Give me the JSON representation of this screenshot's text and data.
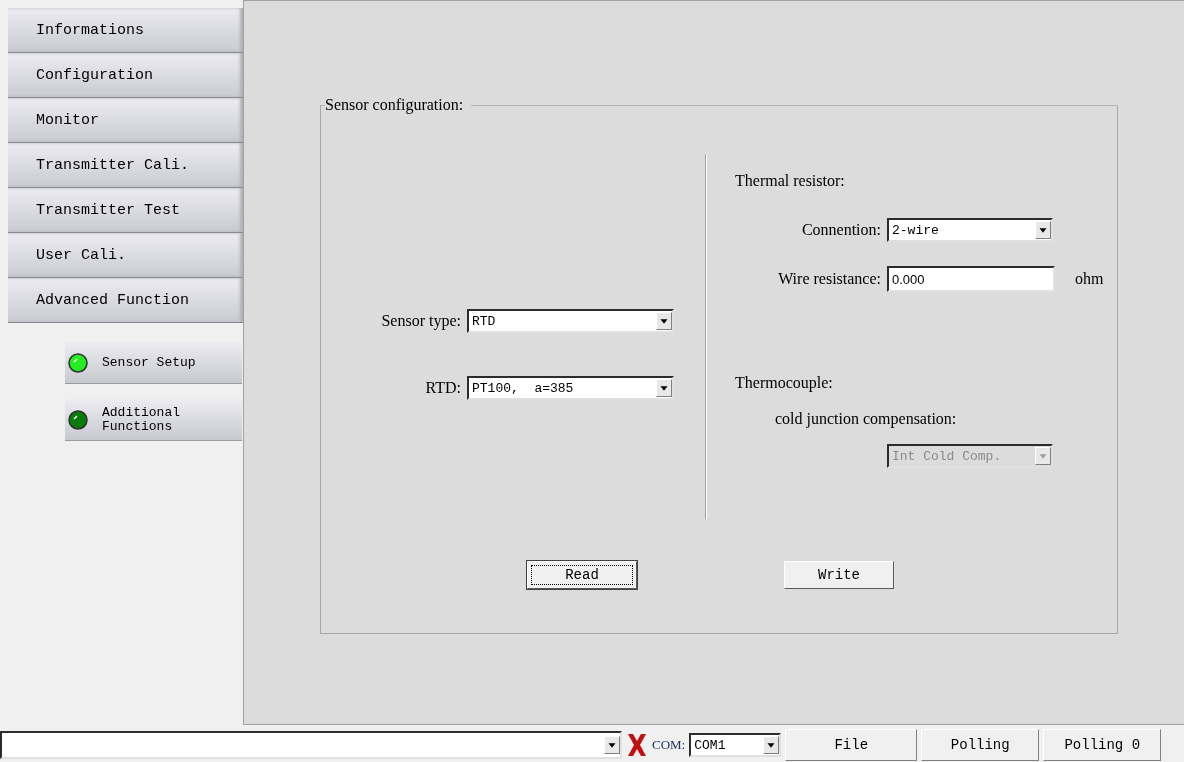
{
  "nav": [
    "Informations",
    "Configuration",
    "Monitor",
    "Transmitter Cali.",
    "Transmitter Test",
    "User Cali.",
    "Advanced Function"
  ],
  "sub_nav": [
    {
      "label": "Sensor Setup",
      "selected": true
    },
    {
      "label": "Additional Functions",
      "selected": false
    }
  ],
  "group": {
    "title": "Sensor configuration:",
    "sensor_type": {
      "label": "Sensor type:",
      "value": "RTD"
    },
    "rtd": {
      "label": "RTD:",
      "value": "PT100,  a=385"
    },
    "thermal_resistor": {
      "title": "Thermal resistor:",
      "connection": {
        "label": "Connention:",
        "value": "2-wire"
      },
      "wire_resistance": {
        "label": "Wire resistance:",
        "value": "0.000",
        "unit": "ohm"
      }
    },
    "thermocouple": {
      "title": "Thermocouple:",
      "cjc_label": "cold junction compensation:",
      "cjc": {
        "value": "Int Cold Comp.",
        "disabled": true
      }
    },
    "buttons": [
      {
        "label": "Read",
        "focused": true
      },
      {
        "label": "Write",
        "focused": false
      }
    ]
  },
  "status_bar": {
    "connected": false,
    "com_label": "COM:",
    "com_value": "COM1",
    "panels": [
      "File",
      "Polling",
      "Polling 0"
    ]
  }
}
